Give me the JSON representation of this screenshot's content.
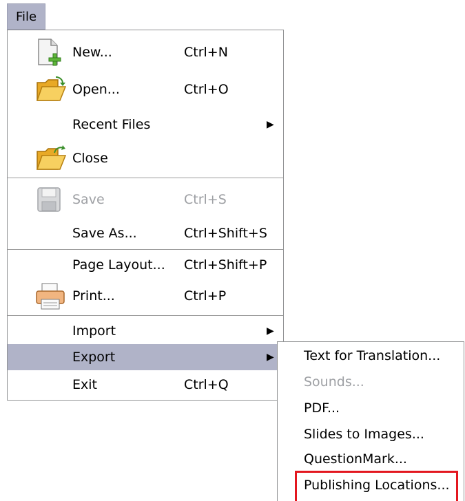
{
  "menubar": {
    "file_label": "File"
  },
  "file_menu": {
    "new": {
      "label": "New...",
      "shortcut": "Ctrl+N",
      "icon": "new-document-icon"
    },
    "open": {
      "label": "Open...",
      "shortcut": "Ctrl+O",
      "icon": "open-folder-icon"
    },
    "recent": {
      "label": "Recent Files"
    },
    "close": {
      "label": "Close",
      "icon": "close-folder-icon"
    },
    "save": {
      "label": "Save",
      "shortcut": "Ctrl+S",
      "icon": "save-disk-icon"
    },
    "save_as": {
      "label": "Save As...",
      "shortcut": "Ctrl+Shift+S"
    },
    "page_layout": {
      "label": "Page Layout...",
      "shortcut": "Ctrl+Shift+P"
    },
    "print": {
      "label": "Print...",
      "shortcut": "Ctrl+P",
      "icon": "printer-icon"
    },
    "import": {
      "label": "Import"
    },
    "export": {
      "label": "Export"
    },
    "exit": {
      "label": "Exit",
      "shortcut": "Ctrl+Q"
    }
  },
  "export_submenu": {
    "items": [
      {
        "label": "Text for Translation...",
        "enabled": true
      },
      {
        "label": "Sounds...",
        "enabled": false
      },
      {
        "label": "PDF...",
        "enabled": true
      },
      {
        "label": "Slides to Images...",
        "enabled": true
      },
      {
        "label": "QuestionMark...",
        "enabled": true
      },
      {
        "label": "Publishing Locations...",
        "enabled": true
      }
    ]
  },
  "colors": {
    "highlight": "#b0b3c8",
    "callout": "#e3171f",
    "disabled_text": "#9ea0a4"
  }
}
